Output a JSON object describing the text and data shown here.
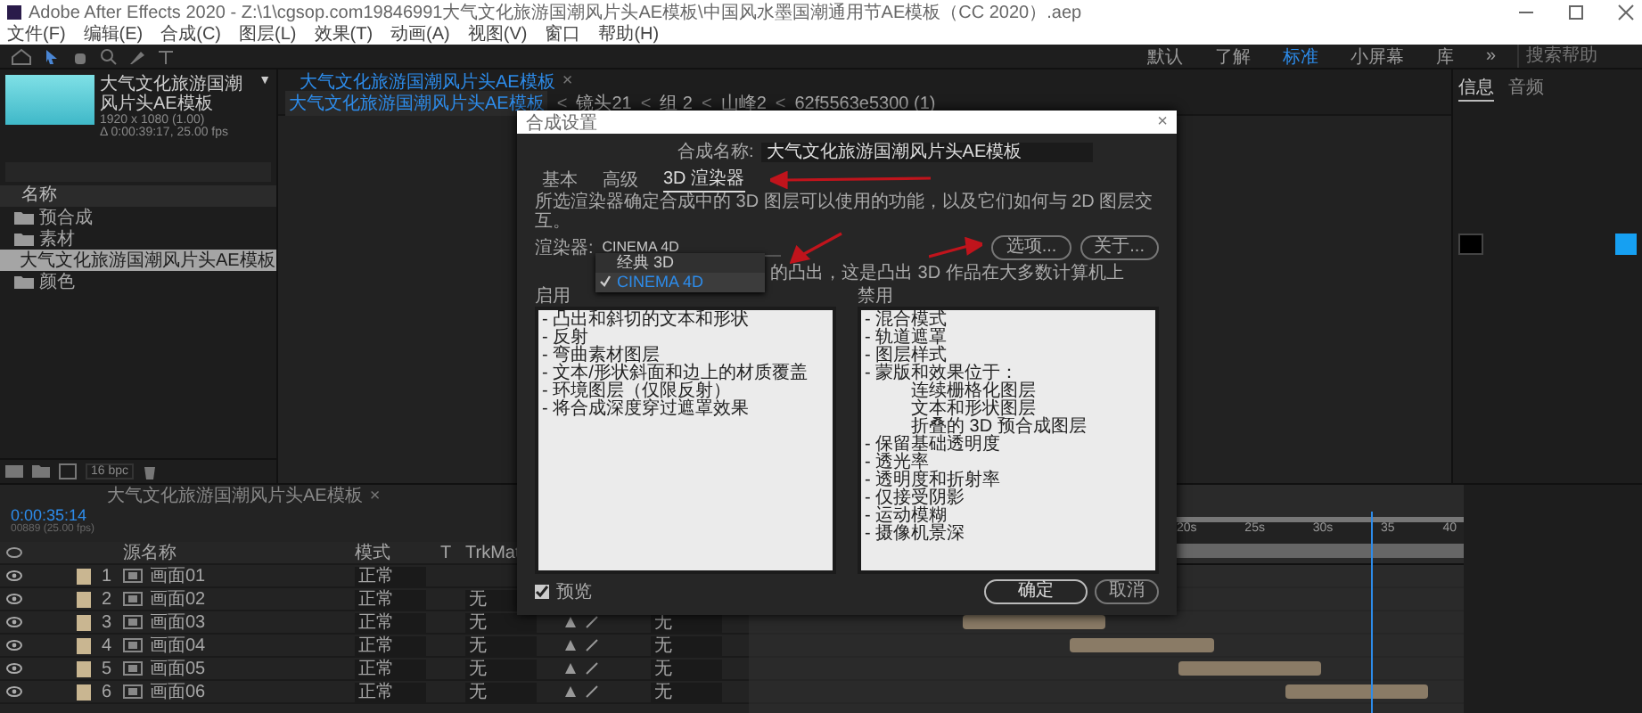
{
  "window": {
    "title": "Adobe After Effects 2020 - Z:\\1\\cgsop.com19846991大气文化旅游国潮风片头AE模板\\中国风水墨国潮通用节AE模板（CC 2020）.aep"
  },
  "menu": [
    "文件(F)",
    "编辑(E)",
    "合成(C)",
    "图层(L)",
    "效果(T)",
    "动画(A)",
    "视图(V)",
    "窗口",
    "帮助(H)"
  ],
  "workspaces": [
    {
      "label": "默认",
      "selected": false
    },
    {
      "label": "了解",
      "selected": false
    },
    {
      "label": "标准",
      "selected": true
    },
    {
      "label": "小屏幕",
      "selected": false
    },
    {
      "label": "库",
      "selected": false
    }
  ],
  "workspace_more": "»",
  "help_search": {
    "placeholder": "搜索帮助"
  },
  "project": {
    "comp_name": "大气文化旅游国潮风片头AE模板",
    "caret": "▼",
    "size": "1920 x 1080 (1.00)",
    "duration": "Δ 0:00:39:17, 25.00 fps",
    "column": "名称",
    "bpc": "16 bpc",
    "items": [
      {
        "kind": "folder",
        "name": "预合成",
        "selected": false
      },
      {
        "kind": "folder",
        "name": "素材",
        "selected": false
      },
      {
        "kind": "comp",
        "name": "大气文化旅游国潮风片头AE模板",
        "selected": true
      },
      {
        "kind": "folder",
        "name": "颜色",
        "selected": false
      }
    ]
  },
  "composition": {
    "tab": "大气文化旅游国潮风片头AE模板",
    "close": "×",
    "breadcrumbs": [
      "大气文化旅游国潮风片头AE模板",
      "镜头21",
      "组 2",
      "山峰2",
      "62f5563e5300 (1)"
    ],
    "separator": "<"
  },
  "right_panel": {
    "tabs": [
      {
        "label": "信息",
        "selected": true
      },
      {
        "label": "音频",
        "selected": false
      }
    ]
  },
  "dialog": {
    "title": "合成设置",
    "close": "×",
    "name_label": "合成名称:",
    "name_value": "大气文化旅游国潮风片头AE模板",
    "tabs": [
      {
        "label": "基本",
        "selected": false
      },
      {
        "label": "高级",
        "selected": false
      },
      {
        "label": "3D 渲染器",
        "selected": true
      }
    ],
    "description": "所选渲染器确定合成中的 3D 图层可以使用的功能，以及它们如何与 2D 图层交互。",
    "renderer_label": "渲染器:",
    "renderer_value": "CINEMA 4D",
    "options_button": "选项...",
    "about_button": "关于...",
    "renderer_menu": [
      {
        "label": "经典 3D",
        "checked": false
      },
      {
        "label": "CINEMA 4D",
        "checked": true
      }
    ],
    "renderer_note": "的凸出，这是凸出 3D 作品在大多数计算机上",
    "enabled_header": "启用",
    "enabled": [
      {
        "text": "- 凸出和斜切的文本和形状"
      },
      {
        "text": "- 反射"
      },
      {
        "text": "- 弯曲素材图层"
      },
      {
        "text": "- 文本/形状斜面和边上的材质覆盖"
      },
      {
        "text": "- 环境图层（仅限反射）"
      },
      {
        "text": "- 将合成深度穿过遮罩效果"
      }
    ],
    "disabled_header": "禁用",
    "disabled": [
      {
        "text": "- 混合模式"
      },
      {
        "text": "- 轨道遮罩"
      },
      {
        "text": "- 图层样式"
      },
      {
        "text": "- 蒙版和效果位于：",
        "children": [
          {
            "text": "连续栅格化图层"
          },
          {
            "text": "文本和形状图层"
          },
          {
            "text": "折叠的 3D 预合成图层"
          }
        ]
      },
      {
        "text": "- 保留基础透明度"
      },
      {
        "text": "- 透光率"
      },
      {
        "text": "- 透明度和折射率"
      },
      {
        "text": "- 仅接受阴影"
      },
      {
        "text": "- 运动模糊"
      },
      {
        "text": "- 摄像机景深"
      }
    ],
    "preview_label": "预览",
    "preview_checked": true,
    "ok_button": "确定",
    "cancel_button": "取消"
  },
  "timeline": {
    "tab": "大气文化旅游国潮风片头AE模板",
    "close": "×",
    "time": "0:00:35:14",
    "frames": "00889 (25.00 fps)",
    "columns": {
      "source": "源名称",
      "mode": "模式",
      "t": "T",
      "trkmat": "TrkMat"
    },
    "ruler": [
      "20s",
      "25s",
      "30s",
      "35",
      "40"
    ],
    "playhead": {
      "level": 0.87
    },
    "layers": [
      {
        "num": "1",
        "name": "画面01",
        "mode": "正常"
      },
      {
        "num": "2",
        "name": "画面02",
        "mode": "正常",
        "trkmat": "无"
      },
      {
        "num": "3",
        "name": "画面03",
        "mode": "正常",
        "trkmat": "无",
        "parent": "无"
      },
      {
        "num": "4",
        "name": "画面04",
        "mode": "正常",
        "trkmat": "无",
        "parent": "无"
      },
      {
        "num": "5",
        "name": "画面05",
        "mode": "正常",
        "trkmat": "无",
        "parent": "无"
      },
      {
        "num": "6",
        "name": "画面06",
        "mode": "正常",
        "trkmat": "无",
        "parent": "无"
      }
    ]
  }
}
